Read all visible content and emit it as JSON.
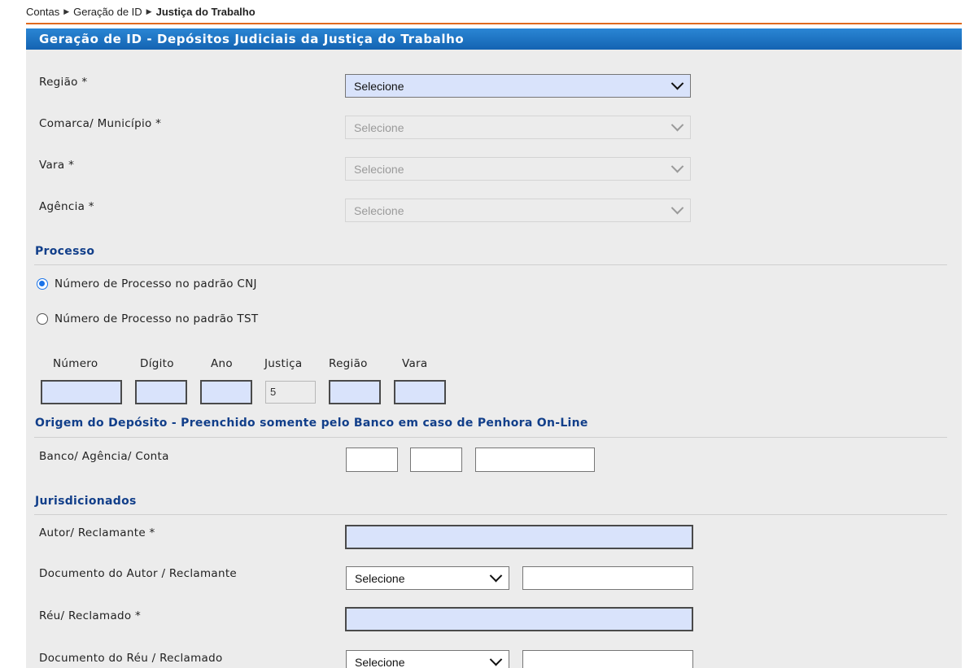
{
  "breadcrumb": {
    "item1": "Contas",
    "item2": "Geração de ID",
    "current": "Justiça do Trabalho",
    "separator_icon": "triangle-right-icon"
  },
  "header": {
    "title": "Geração de ID - Depósitos Judiciais da Justiça do Trabalho"
  },
  "fields": {
    "regiao": {
      "label": "Região *",
      "value": "Selecione"
    },
    "comarca": {
      "label": "Comarca/ Município *",
      "value": "Selecione"
    },
    "vara": {
      "label": "Vara *",
      "value": "Selecione"
    },
    "agencia": {
      "label": "Agência *",
      "value": "Selecione"
    }
  },
  "processo": {
    "title": "Processo",
    "radio_cnj": "Número de Processo no padrão CNJ",
    "radio_tst": "Número de Processo no padrão TST",
    "selected": "cnj",
    "columns": {
      "numero": "Número",
      "digito": "Dígito",
      "ano": "Ano",
      "justica": "Justiça",
      "regiao": "Região",
      "vara": "Vara"
    },
    "justica_value": "5"
  },
  "origem": {
    "title": "Origem do Depósito - Preenchido somente pelo Banco em caso de Penhora On-Line",
    "label": "Banco/ Agência/ Conta"
  },
  "jurisdicionados": {
    "title": "Jurisdicionados",
    "autor_label": "Autor/ Reclamante *",
    "doc_autor_label": "Documento do Autor / Reclamante",
    "doc_autor_value": "Selecione",
    "reu_label": "Réu/ Reclamado *",
    "doc_reu_label": "Documento do Réu / Reclamado",
    "doc_reu_value": "Selecione"
  },
  "colors": {
    "header": "#1a6fc4",
    "accent_line": "#e06a1e",
    "section_title": "#123f8a",
    "input_active": "#d9e3fb"
  }
}
